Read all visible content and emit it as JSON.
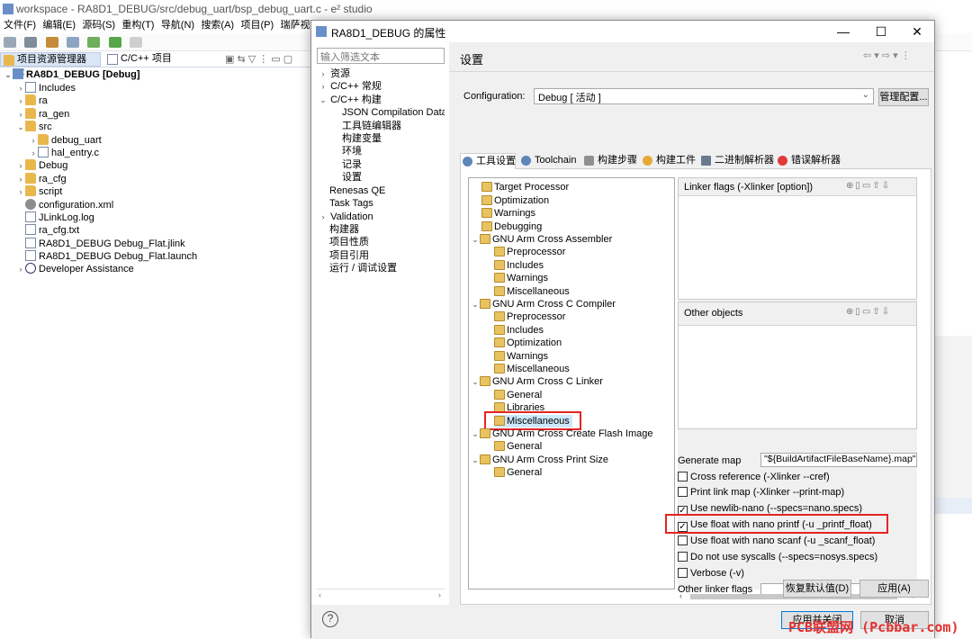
{
  "main": {
    "title": "workspace - RA8D1_DEBUG/src/debug_uart/bsp_debug_uart.c - e² studio",
    "menu": [
      "文件(F)",
      "编辑(E)",
      "源码(S)",
      "重构(T)",
      "导航(N)",
      "搜索(A)",
      "项目(P)",
      "瑞萨视图(V)",
      "运"
    ],
    "tabs": [
      "项目资源管理器",
      "C/C++ 项目"
    ],
    "tree": [
      {
        "label": "RA8D1_DEBUG [Debug]",
        "icon": "project-icon"
      },
      {
        "label": "Includes",
        "icon": "includes-icon"
      },
      {
        "label": "ra",
        "icon": "folder-icon"
      },
      {
        "label": "ra_gen",
        "icon": "folder-icon"
      },
      {
        "label": "src",
        "icon": "folder-icon"
      },
      {
        "label": "debug_uart",
        "icon": "folder-icon"
      },
      {
        "label": "hal_entry.c",
        "icon": "c-file-icon"
      },
      {
        "label": "Debug",
        "icon": "folder-icon"
      },
      {
        "label": "ra_cfg",
        "icon": "folder-icon"
      },
      {
        "label": "script",
        "icon": "folder-icon"
      },
      {
        "label": "configuration.xml",
        "icon": "gear-icon"
      },
      {
        "label": "JLinkLog.log",
        "icon": "file-icon"
      },
      {
        "label": "ra_cfg.txt",
        "icon": "file-icon"
      },
      {
        "label": "RA8D1_DEBUG Debug_Flat.jlink",
        "icon": "file-icon"
      },
      {
        "label": "RA8D1_DEBUG Debug_Flat.launch",
        "icon": "launch-file-icon"
      },
      {
        "label": "Developer Assistance",
        "icon": "help-icon"
      }
    ]
  },
  "dialog": {
    "title": "RA8D1_DEBUG 的属性",
    "filter_placeholder": "输入筛选文本",
    "nav": [
      "资源",
      "C/C++ 常规",
      "C/C++ 构建",
      "JSON Compilation Data",
      "工具链编辑器",
      "构建变量",
      "环境",
      "记录",
      "设置",
      "Renesas QE",
      "Task Tags",
      "Validation",
      "构建器",
      "项目性质",
      "项目引用",
      "运行 / 调试设置"
    ],
    "settings_title": "设置",
    "configuration_label": "Configuration:",
    "configuration_value": "Debug  [ 活动 ]",
    "manage_button": "管理配置...",
    "tool_tabs": [
      "工具设置",
      "Toolchain",
      "构建步骤",
      "构建工件",
      "二进制解析器",
      "错误解析器"
    ],
    "tool_tree": [
      "Target Processor",
      "Optimization",
      "Warnings",
      "Debugging",
      "GNU Arm Cross Assembler",
      "Preprocessor",
      "Includes",
      "Warnings",
      "Miscellaneous",
      "GNU Arm Cross C Compiler",
      "Preprocessor",
      "Includes",
      "Optimization",
      "Warnings",
      "Miscellaneous",
      "GNU Arm Cross C Linker",
      "General",
      "Libraries",
      "Miscellaneous",
      "GNU Arm Cross Create Flash Image",
      "General",
      "GNU Arm Cross Print Size",
      "General"
    ],
    "linker_flags_title": "Linker flags (-Xlinker [option])",
    "other_objects_title": "Other objects",
    "generate_map_label": "Generate map",
    "generate_map_value": "\"${BuildArtifactFileBaseName}.map\"",
    "options": [
      {
        "label": "Cross reference (-Xlinker --cref)",
        "checked": false
      },
      {
        "label": "Print link map (-Xlinker --print-map)",
        "checked": false
      },
      {
        "label": "Use newlib-nano (--specs=nano.specs)",
        "checked": true
      },
      {
        "label": "Use float with nano printf (-u _printf_float)",
        "checked": true
      },
      {
        "label": "Use float with nano scanf (-u _scanf_float)",
        "checked": false
      },
      {
        "label": "Do not use syscalls (--specs=nosys.specs)",
        "checked": false
      },
      {
        "label": "Verbose (-v)",
        "checked": false
      }
    ],
    "other_linker_flags_label": "Other linker flags",
    "restore_defaults_button": "恢复默认值(D)",
    "apply_button": "应用(A)",
    "apply_close_button": "应用并关闭",
    "cancel_button": "取消"
  },
  "watermark": "PCB联盟网 (Pcbbar.com)",
  "colors": {
    "highlight": "#e52424",
    "accent": "#0078d7"
  }
}
